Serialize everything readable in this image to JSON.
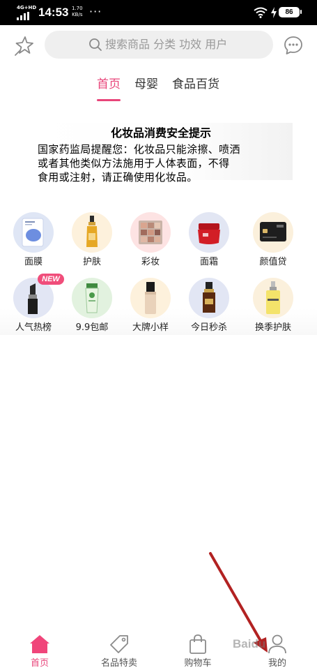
{
  "status_bar": {
    "network": "4G+HD",
    "time": "14:53",
    "speed_value": "1.70",
    "speed_unit": "KB/s",
    "more": "···",
    "battery": "86"
  },
  "header": {
    "search_placeholder": "搜索商品 分类 功效 用户"
  },
  "tabs": [
    {
      "label": "首页",
      "active": true
    },
    {
      "label": "母婴",
      "active": false
    },
    {
      "label": "食品百货",
      "active": false
    }
  ],
  "notice": {
    "title": "化妆品消费安全提示",
    "line1": "国家药监局提醒您：化妆品只能涂擦、喷洒",
    "line2": "或者其他类似方法施用于人体表面，不得",
    "line3": "食用或注射，请正确使用化妆品。"
  },
  "categories": [
    {
      "label": "面膜",
      "icon": "face-mask-icon",
      "bg": "#dfe6f5"
    },
    {
      "label": "护肤",
      "icon": "serum-bottle-icon",
      "bg": "#fdf1dc"
    },
    {
      "label": "彩妆",
      "icon": "eyeshadow-palette-icon",
      "bg": "#fde3e3"
    },
    {
      "label": "面霜",
      "icon": "cream-jar-icon",
      "bg": "#e2e6f3"
    },
    {
      "label": "颜值贷",
      "icon": "credit-card-icon",
      "bg": "#fbf0dc"
    },
    {
      "label": "人气热榜",
      "icon": "lipstick-icon",
      "bg": "#e2e6f4",
      "badge": "NEW"
    },
    {
      "label": "9.9包邮",
      "icon": "tube-icon",
      "bg": "#e2f2df"
    },
    {
      "label": "大牌小样",
      "icon": "foundation-bottle-icon",
      "bg": "#fdf1dc"
    },
    {
      "label": "今日秒杀",
      "icon": "essence-bottle-icon",
      "bg": "#e2e6f4"
    },
    {
      "label": "换季护肤",
      "icon": "clinique-bottle-icon",
      "bg": "#fbf0dc"
    }
  ],
  "bottom_nav": [
    {
      "label": "首页",
      "icon": "home-icon",
      "active": true
    },
    {
      "label": "名品特卖",
      "icon": "tag-icon",
      "active": false
    },
    {
      "label": "购物车",
      "icon": "shopping-bag-icon",
      "active": false
    },
    {
      "label": "我的",
      "icon": "profile-icon",
      "active": false
    }
  ],
  "colors": {
    "accent": "#e8457a",
    "annotation_arrow": "#b22222"
  },
  "overlay": {
    "watermark": "Baidu"
  }
}
